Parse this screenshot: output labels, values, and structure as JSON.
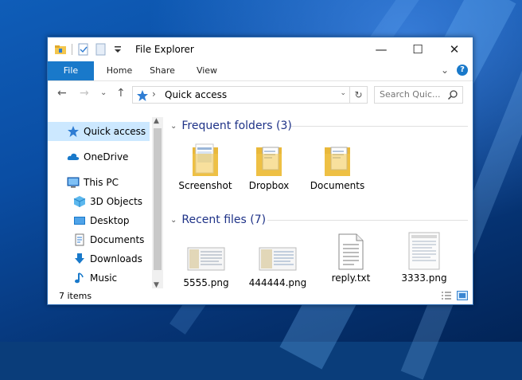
{
  "window": {
    "title": "File Explorer",
    "buttons": {
      "minimize": "—",
      "maximize": "☐",
      "close": "✕"
    }
  },
  "ribbon": {
    "tabs": [
      "File",
      "Home",
      "Share",
      "View"
    ],
    "expand": "⌄",
    "help": "?"
  },
  "nav": {
    "back": "←",
    "forward": "→",
    "recent": "⌄",
    "up": "↑",
    "address": {
      "path": "Quick access",
      "separator": "›",
      "dropdown": "⌄"
    },
    "refresh": "↻",
    "search": {
      "placeholder": "Search Quic...",
      "icon": "search-icon"
    }
  },
  "sidebar": {
    "items": [
      {
        "label": "Quick access",
        "icon": "star-icon",
        "selected": true
      },
      {
        "label": "OneDrive",
        "icon": "cloud-icon"
      },
      {
        "label": "This PC",
        "icon": "monitor-icon"
      },
      {
        "label": "3D Objects",
        "icon": "cube-icon"
      },
      {
        "label": "Desktop",
        "icon": "desktop-icon"
      },
      {
        "label": "Documents",
        "icon": "document-icon"
      },
      {
        "label": "Downloads",
        "icon": "download-icon"
      },
      {
        "label": "Music",
        "icon": "music-icon"
      }
    ]
  },
  "content": {
    "frequent": {
      "header": "Frequent folders (3)",
      "items": [
        {
          "label": "Screenshot",
          "icon": "folder-icon"
        },
        {
          "label": "Dropbox",
          "icon": "folder-icon"
        },
        {
          "label": "Documents",
          "icon": "folder-icon"
        }
      ]
    },
    "recent": {
      "header": "Recent files (7)",
      "items": [
        {
          "label": "5555.png",
          "icon": "image-file-icon"
        },
        {
          "label": "444444.png",
          "icon": "image-file-icon"
        },
        {
          "label": "reply.txt",
          "icon": "text-file-icon"
        },
        {
          "label": "3333.png",
          "icon": "image-file-icon"
        }
      ]
    }
  },
  "status": {
    "count": "7 items"
  },
  "colors": {
    "accent": "#1979ca",
    "selected": "#cce8ff",
    "groupHeader": "#1e3287",
    "folder": "#f3c64d"
  }
}
